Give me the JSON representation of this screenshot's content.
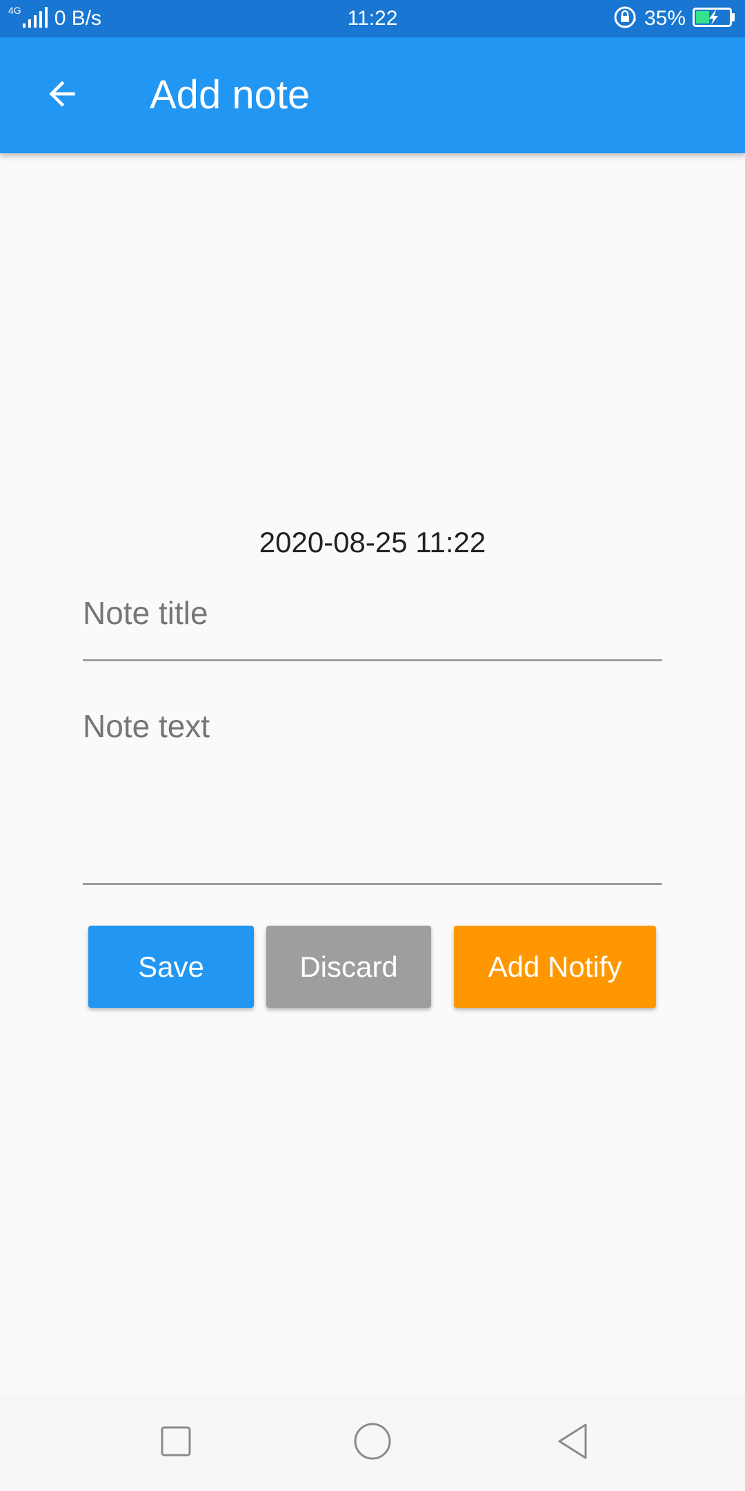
{
  "status_bar": {
    "network_type": "4G",
    "net_speed": "0 B/s",
    "time": "11:22",
    "battery_percent": "35%",
    "icons": [
      "signal-icon",
      "rotation-lock-icon",
      "battery-charging-icon"
    ]
  },
  "app_bar": {
    "title": "Add note",
    "back_icon": "arrow-left-icon"
  },
  "form": {
    "date": "2020-08-25 11:22",
    "title_placeholder": "Note title",
    "title_value": "",
    "text_placeholder": "Note text",
    "text_value": ""
  },
  "buttons": {
    "save": "Save",
    "discard": "Discard",
    "add_notify": "Add Notify"
  },
  "colors": {
    "status_bar": "#1976d2",
    "app_bar": "#2196f3",
    "save": "#2196f3",
    "discard": "#9e9e9e",
    "add_notify": "#ff9800",
    "battery_fill": "#33e28a"
  },
  "nav_bar": {
    "icons": [
      "recent-apps-icon",
      "home-icon",
      "back-icon"
    ]
  }
}
